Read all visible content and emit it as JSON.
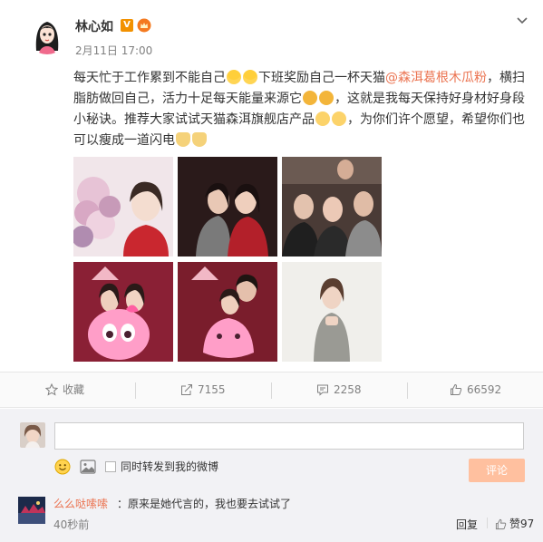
{
  "post": {
    "username": "林心如",
    "badge_v": "V",
    "time": "2月11日 17:00",
    "content": {
      "part1": "每天忙于工作累到不能自己",
      "part2": "下班奖励自己一杯天猫",
      "mention": "@森洱葛根木瓜粉",
      "part3": "，横扫脂肪做回自己，活力十足每天能量来源它",
      "part4": "，这就是我每天保持好身材好身段小秘诀。推荐大家试试天猫森洱旗舰店产品",
      "part5": "，为你们许个愿望，希望你们也可以瘦成一道闪电"
    },
    "photos": [
      "photo-1",
      "photo-2",
      "photo-3",
      "photo-4",
      "photo-5",
      "photo-6"
    ]
  },
  "actions": {
    "favorite_label": "收藏",
    "repost_count": "7155",
    "comment_count": "2258",
    "like_count": "66592"
  },
  "comment_box": {
    "input_value": "",
    "repost_label": "同时转发到我的微博",
    "submit_label": "评论"
  },
  "comments": [
    {
      "name": "么么哒嗦嗦",
      "text": "：原来是她代言的，我也要去试试了",
      "time": "40秒前",
      "reply_label": "回复",
      "like_label": "赞",
      "like_count": "97"
    }
  ],
  "colors": {
    "accent": "#eb7350",
    "submit_disabled": "#ffc09f",
    "vip_badge": "#f29100"
  }
}
